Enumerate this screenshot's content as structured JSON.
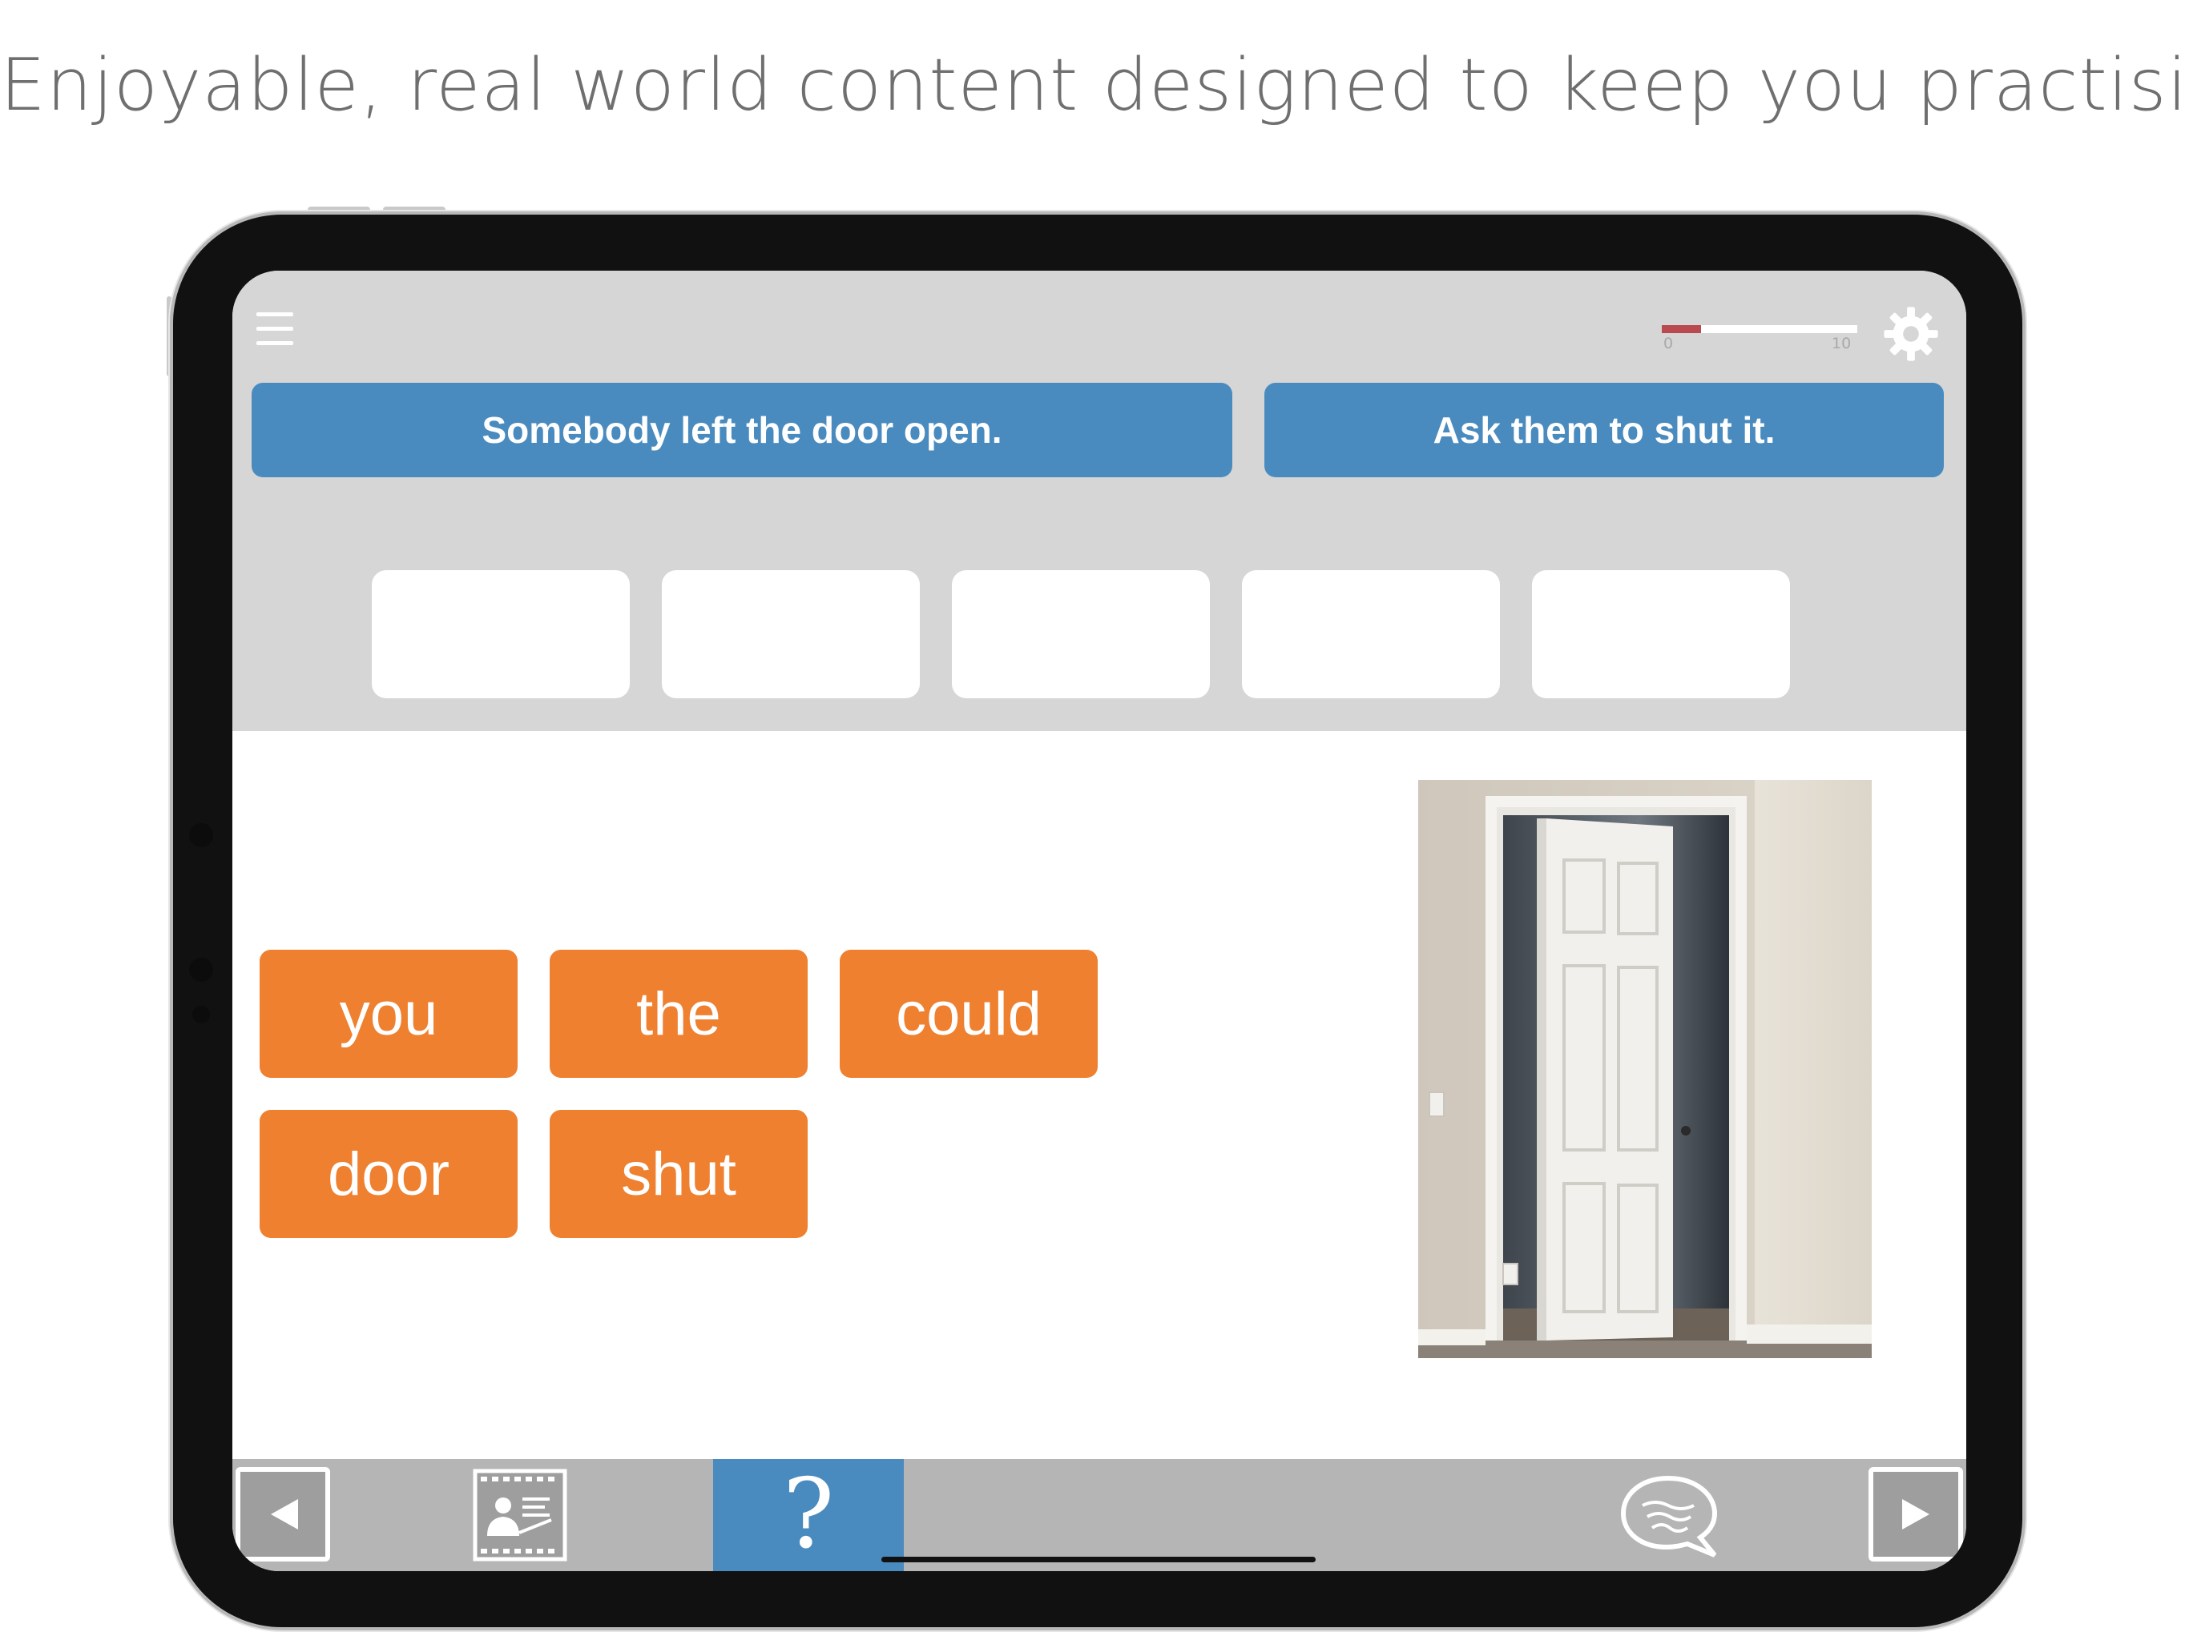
{
  "headline": "Enjoyable, real world content designed to keep you practising",
  "app": {
    "progress": {
      "min_label": "0",
      "max_label": "10",
      "value": 2,
      "max": 10,
      "color": "#b94a4f"
    },
    "prompts": {
      "situation": "Somebody left the door open.",
      "task": "Ask them to shut it."
    },
    "answer_slots": [
      "",
      "",
      "",
      "",
      ""
    ],
    "word_tiles": [
      "you",
      "the",
      "could",
      "door",
      "shut"
    ],
    "photo": {
      "subject": "open white panel door",
      "icon": "door-photo"
    },
    "bottom_bar": {
      "help_label": "?",
      "icons": [
        "previous-arrow-icon",
        "lesson-video-icon",
        "help-icon",
        "speech-bubble-icon",
        "next-arrow-icon"
      ]
    },
    "colors": {
      "accent_blue": "#4a8bbf",
      "tile_orange": "#ee8030",
      "panel_gray": "#d6d6d6",
      "bar_gray": "#b5b5b5"
    }
  }
}
